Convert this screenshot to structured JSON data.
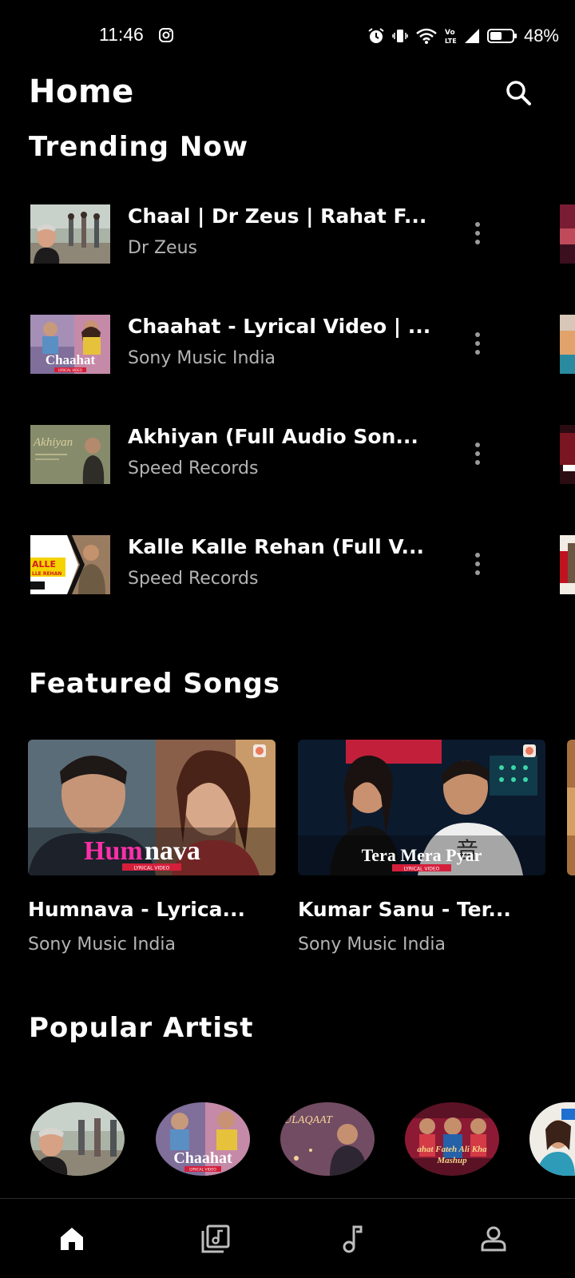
{
  "status": {
    "time": "11:46",
    "battery_percent": "48%"
  },
  "header": {
    "title": "Home"
  },
  "sections": {
    "trending": "Trending Now",
    "featured": "Featured Songs",
    "artists": "Popular Artist"
  },
  "trending": [
    {
      "title": "Chaal | Dr Zeus | Rahat F...",
      "channel": "Dr Zeus"
    },
    {
      "title": "Chaahat - Lyrical Video | ...",
      "channel": "Sony Music India"
    },
    {
      "title": "Akhiyan (Full Audio Son...",
      "channel": "Speed Records"
    },
    {
      "title": "Kalle Kalle Rehan (Full V...",
      "channel": "Speed Records"
    }
  ],
  "thumbnail_text": {
    "chaahat": "Chaahat",
    "chaahat_sub": "LYRICAL VIDEO",
    "akhiyan": "Akhiyan",
    "kalle": "ALLE",
    "kalle_sub": "LLE REHAN",
    "humnava_a": "Hum",
    "humnava_b": "nava",
    "humnava_sub": "LYRICAL VIDEO",
    "tera": "Tera Mera Pyar",
    "tera_sub": "LYRICAL VIDEO",
    "mulaqaat": "ULAQAAT",
    "mashup": "ahat Fateh Ali Kha",
    "mashup_sub": "Mashup"
  },
  "featured": [
    {
      "title": "Humnava - Lyrica...",
      "channel": "Sony Music India"
    },
    {
      "title": "Kumar Sanu - Ter...",
      "channel": "Sony Music India"
    }
  ],
  "nav": {
    "items": [
      "home-icon",
      "library-icon",
      "music-note-icon",
      "profile-icon"
    ],
    "active_color": "#ffffff"
  },
  "colors": {
    "background": "#000000",
    "secondary_text": "#b4b4b4",
    "humnava_pink": "#ff2fa8"
  }
}
